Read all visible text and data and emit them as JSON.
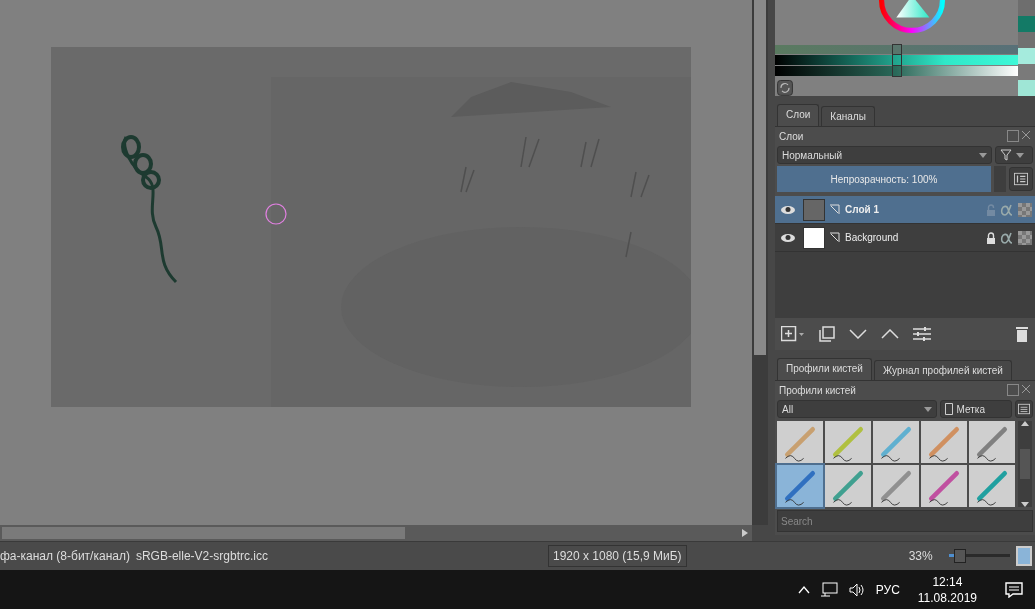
{
  "color_selector": {
    "sliders": [
      {
        "level": 0.5
      },
      {
        "level": 0.5
      },
      {
        "level": 0.5
      }
    ],
    "recent_colors": [
      {
        "color": "#6e6e6e"
      },
      {
        "color": "#137a66"
      },
      {
        "color": "#707070"
      },
      {
        "color": "#a5ebdd"
      },
      {
        "color": "#7a7a7a"
      },
      {
        "color": "#9fe6d6"
      }
    ]
  },
  "layers_docker": {
    "tabs": [
      {
        "label": "Слои",
        "selected": true
      },
      {
        "label": "Каналы",
        "selected": false
      }
    ],
    "title": "Слои",
    "blend_mode": "Нормальный",
    "opacity_label": "Непрозрачность:  100%",
    "opacity": {
      "level": 1
    },
    "layers": [
      {
        "name": "Слой 1",
        "selected": true,
        "visible": true,
        "locked": false
      },
      {
        "name": "Background",
        "selected": false,
        "visible": true,
        "locked": true
      }
    ]
  },
  "brush_docker": {
    "tabs": [
      {
        "label": "Профили кистей",
        "selected": true
      },
      {
        "label": "Журнал профилей кистей",
        "selected": false
      }
    ],
    "title": "Профили кистей",
    "filter": "All",
    "tag": "Метка",
    "search": {
      "placeholder": "Search"
    },
    "presets": [
      {
        "selected": false
      },
      {
        "selected": false
      },
      {
        "selected": false
      },
      {
        "selected": false
      },
      {
        "selected": false
      },
      {
        "selected": true
      },
      {
        "selected": false
      },
      {
        "selected": false
      },
      {
        "selected": false
      },
      {
        "selected": false
      }
    ]
  },
  "status_bar": {
    "color_space": "фа-канал (8-бит/канал)",
    "profile": "sRGB-elle-V2-srgbtrc.icc",
    "size": "1920 x 1080 (15,9 МиБ)",
    "zoom": "33%",
    "zoom_slider": {
      "level": 0.08
    }
  },
  "taskbar": {
    "language": "РУС",
    "time": "12:14",
    "date": "11.08.2019"
  }
}
